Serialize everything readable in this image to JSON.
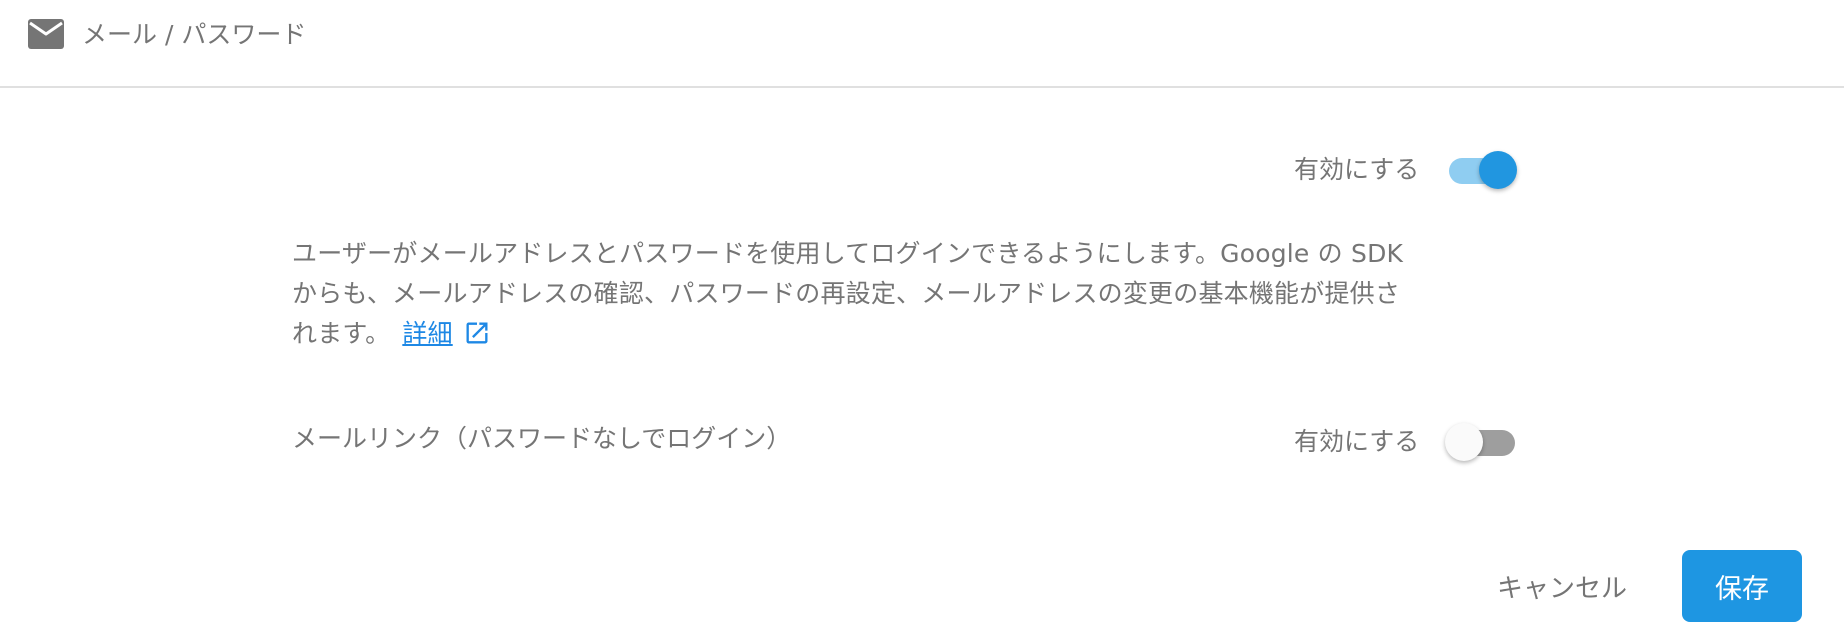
{
  "header": {
    "icon": "mail-icon",
    "title": "メール / パスワード"
  },
  "email_password": {
    "toggle_label": "有効にする",
    "enabled": true
  },
  "description": {
    "line1": "ユーザーがメールアドレスとパスワードを使用してログインできるようにします。Google の SDK",
    "line2": "からも、メールアドレスの確認、パスワードの再設定、メールアドレスの変更の基本機能が提供さ",
    "line3": "れます。",
    "link_label": "詳細",
    "link_icon": "open-in-new-icon"
  },
  "email_link": {
    "label": "メールリンク（パスワードなしでログイン）",
    "toggle_label": "有効にする",
    "enabled": false
  },
  "actions": {
    "cancel_label": "キャンセル",
    "save_label": "保存"
  },
  "colors": {
    "accent": "#1e96e2",
    "switch_on_track": "#8fcdf1",
    "switch_off_track": "#9e9e9e",
    "text": "#757575",
    "link": "#1e88e5"
  }
}
